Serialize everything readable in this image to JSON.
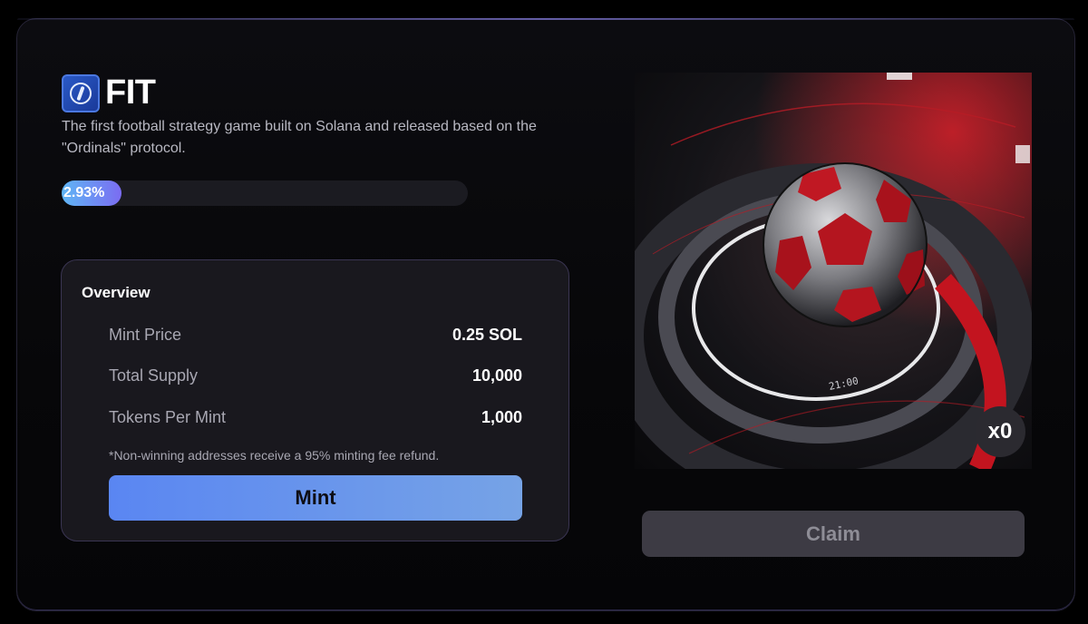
{
  "project": {
    "name": "FIT",
    "description": "The first football strategy game built on Solana and released based on the \"Ordinals\" protocol.",
    "logo_icon": "fit-logo-icon"
  },
  "progress": {
    "label": "2.93%",
    "value_percent": 2.93
  },
  "overview": {
    "title": "Overview",
    "rows": [
      {
        "label": "Mint Price",
        "value": "0.25 SOL"
      },
      {
        "label": "Total Supply",
        "value": "10,000"
      },
      {
        "label": "Tokens Per Mint",
        "value": "1,000"
      }
    ],
    "note": "*Non-winning addresses receive a 95% minting fee refund.",
    "mint_label": "Mint"
  },
  "artwork": {
    "subject": "football-artwork-image",
    "count_badge": "x0"
  },
  "claim_label": "Claim",
  "colors": {
    "accent_start": "#5a86f2",
    "accent_end": "#76a3e6",
    "progress_start": "#5fb6f5",
    "progress_end": "#7b6cf2",
    "panel_bg": "#19181e",
    "claim_bg": "#3d3b44"
  }
}
